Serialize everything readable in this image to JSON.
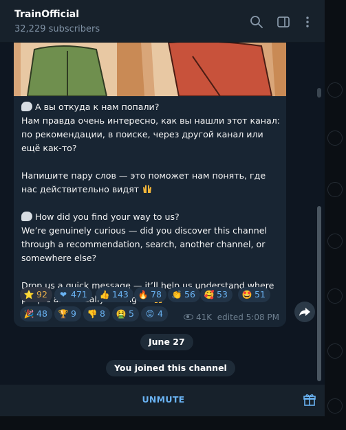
{
  "header": {
    "title": "TrainOfficial",
    "subscribers": "32,229 subscribers"
  },
  "message": {
    "ru_q": "А вы откуда к нам попали?",
    "ru_body": "Нам правда очень интересно, как вы нашли этот канал: по рекомендации, в поиске, через другой канал или ещё как-то?",
    "ru_ask": "Напишите пару слов — это поможет нам понять, где нас действительно видят",
    "en_q": "How did you find your way to us?",
    "en_body": "We’re genuinely curious — did you discover this channel through a recommendation, search, another channel, or somewhere else?",
    "en_ask": "Drop us a quick message — it’ll help us understand where people are actually finding us",
    "views": "41K",
    "edited": "edited 5:08 PM"
  },
  "reactions": [
    {
      "emoji": "⭐",
      "count": "92",
      "paid": true
    },
    {
      "emoji": "❤",
      "count": "471"
    },
    {
      "emoji": "👍",
      "count": "143"
    },
    {
      "emoji": "🔥",
      "count": "78"
    },
    {
      "emoji": "👏",
      "count": "56"
    },
    {
      "emoji": "🥰",
      "count": "53"
    },
    {
      "emoji": "🤩",
      "count": "51"
    },
    {
      "emoji": "🎉",
      "count": "48"
    },
    {
      "emoji": "🏆",
      "count": "9"
    },
    {
      "emoji": "👎",
      "count": "8"
    },
    {
      "emoji": "🤮",
      "count": "5"
    },
    {
      "emoji": "😡",
      "count": "4"
    }
  ],
  "date_separator": "June 27",
  "service_message": "You joined this channel",
  "bottom": {
    "unmute_label": "UNMUTE"
  },
  "icons": {
    "search": "search-icon",
    "sidebar": "sidebar-toggle-icon",
    "more": "more-vertical-icon",
    "share": "share-icon",
    "gift": "gift-icon",
    "views": "eye-icon"
  },
  "colors": {
    "accent": "#6ab3f3",
    "background": "#0e1621",
    "bubble": "#182533",
    "header": "#17212b"
  }
}
